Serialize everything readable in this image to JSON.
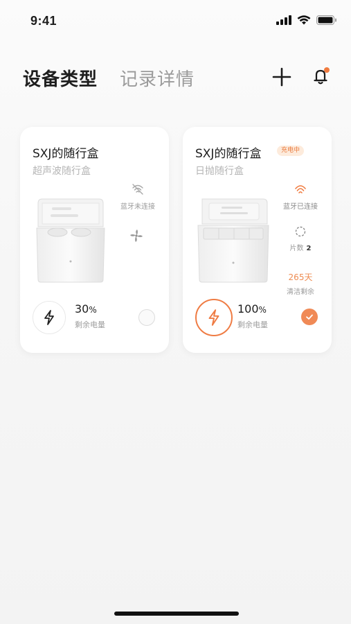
{
  "status_bar": {
    "time": "9:41"
  },
  "header": {
    "tabs": [
      {
        "label": "设备类型",
        "active": true
      },
      {
        "label": "记录详情",
        "active": false
      }
    ],
    "accent_color": "#F07B3F"
  },
  "devices": [
    {
      "name": "SXJ的随行盒",
      "type": "超声波随行盒",
      "bluetooth_status": "蓝牙未连接",
      "bluetooth_icon": "bluetooth-disconnected-icon",
      "battery_value": "30",
      "battery_unit": "%",
      "battery_label": "剩余电量",
      "battery_level": 0.3,
      "selected": false
    },
    {
      "name": "SXJ的随行盒",
      "type": "日抛随行盒",
      "badge": "充电中",
      "bluetooth_status": "蓝牙已连接",
      "bluetooth_icon": "bluetooth-connected-icon",
      "lens_label": "片数",
      "lens_count": "2",
      "clean_days": "265天",
      "clean_label": "清洁剩余",
      "battery_value": "100",
      "battery_unit": "%",
      "battery_label": "剩余电量",
      "battery_level": 1.0,
      "selected": true
    }
  ]
}
